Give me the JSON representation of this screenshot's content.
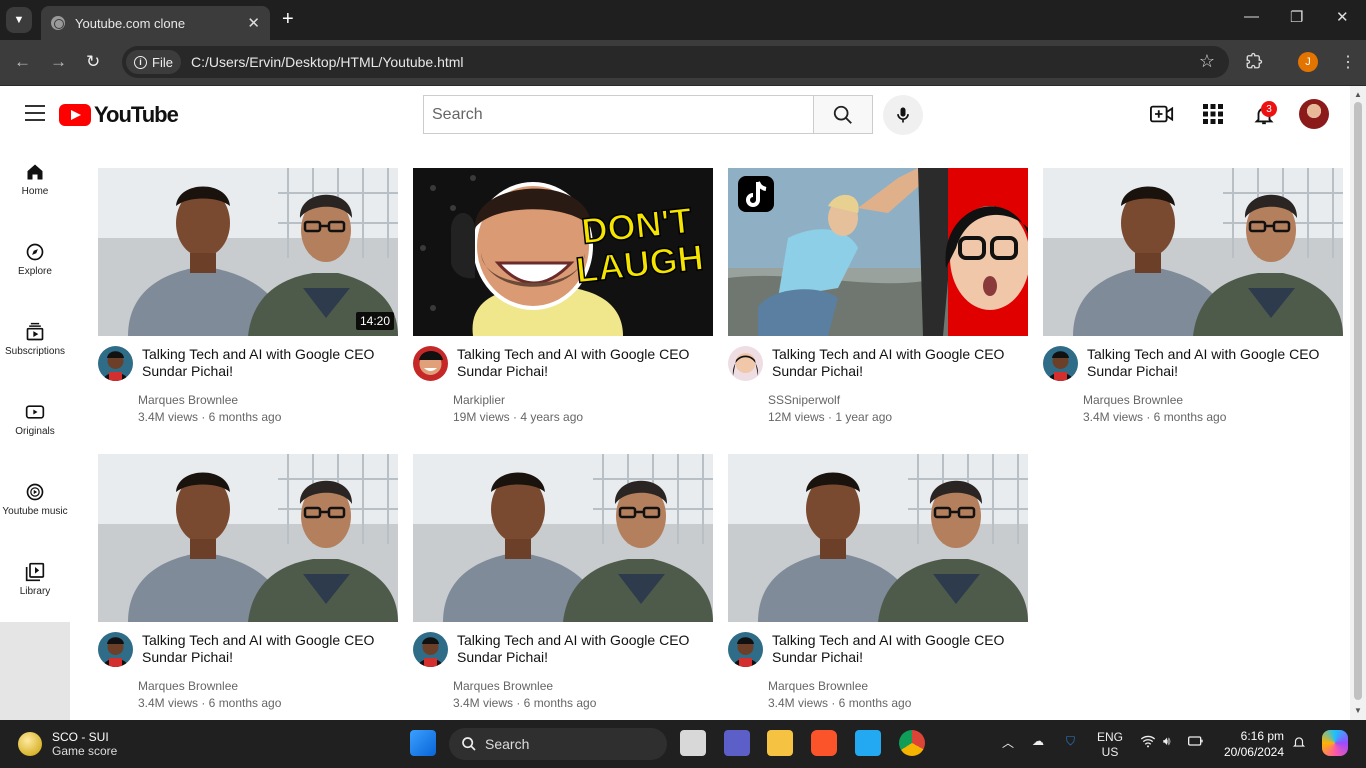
{
  "browser": {
    "tab_title": "Youtube.com clone",
    "url_chip": "File",
    "url": "C:/Users/Ervin/Desktop/HTML/Youtube.html",
    "profile_initial": "J"
  },
  "header": {
    "logo_text": "YouTube",
    "search_placeholder": "Search",
    "notification_count": "3"
  },
  "sidebar": {
    "items": [
      {
        "label": "Home",
        "icon": "home-icon"
      },
      {
        "label": "Explore",
        "icon": "compass-icon"
      },
      {
        "label": "Subscriptions",
        "icon": "subscriptions-icon"
      },
      {
        "label": "Originals",
        "icon": "originals-icon"
      },
      {
        "label": "Youtube music",
        "icon": "music-icon"
      },
      {
        "label": "Library",
        "icon": "library-icon"
      }
    ]
  },
  "videos": [
    {
      "title": "Talking Tech and AI with Google CEO Sundar Pichai!",
      "channel": "Marques Brownlee",
      "meta": "3.4M views · 6 months ago",
      "duration": "14:20",
      "thumb": "mkbhd"
    },
    {
      "title": "Talking Tech and AI with Google CEO Sundar Pichai!",
      "channel": "Markiplier",
      "meta": "19M views · 4 years ago",
      "duration": "",
      "thumb": "markiplier",
      "thumb_text_1": "DON'T",
      "thumb_text_2": "LAUGH"
    },
    {
      "title": "Talking Tech and AI with Google CEO Sundar Pichai!",
      "channel": "SSSniperwolf",
      "meta": "12M views · 1 year ago",
      "duration": "",
      "thumb": "sssniperwolf"
    },
    {
      "title": "Talking Tech and AI with Google CEO Sundar Pichai!",
      "channel": "Marques Brownlee",
      "meta": "3.4M views · 6 months ago",
      "duration": "",
      "thumb": "mkbhd"
    },
    {
      "title": "Talking Tech and AI with Google CEO Sundar Pichai!",
      "channel": "Marques Brownlee",
      "meta": "3.4M views · 6 months ago",
      "duration": "",
      "thumb": "mkbhd"
    },
    {
      "title": "Talking Tech and AI with Google CEO Sundar Pichai!",
      "channel": "Marques Brownlee",
      "meta": "3.4M views · 6 months ago",
      "duration": "",
      "thumb": "mkbhd"
    },
    {
      "title": "Talking Tech and AI with Google CEO Sundar Pichai!",
      "channel": "Marques Brownlee",
      "meta": "3.4M views · 6 months ago",
      "duration": "",
      "thumb": "mkbhd"
    }
  ],
  "taskbar": {
    "widget_title": "SCO - SUI",
    "widget_subtitle": "Game score",
    "search_label": "Search",
    "lang_1": "ENG",
    "lang_2": "US",
    "time": "6:16 pm",
    "date": "20/06/2024"
  },
  "colors": {
    "brand_red": "#ff0000",
    "browser_dark": "#3c3c3c",
    "taskbar": "#202020"
  }
}
